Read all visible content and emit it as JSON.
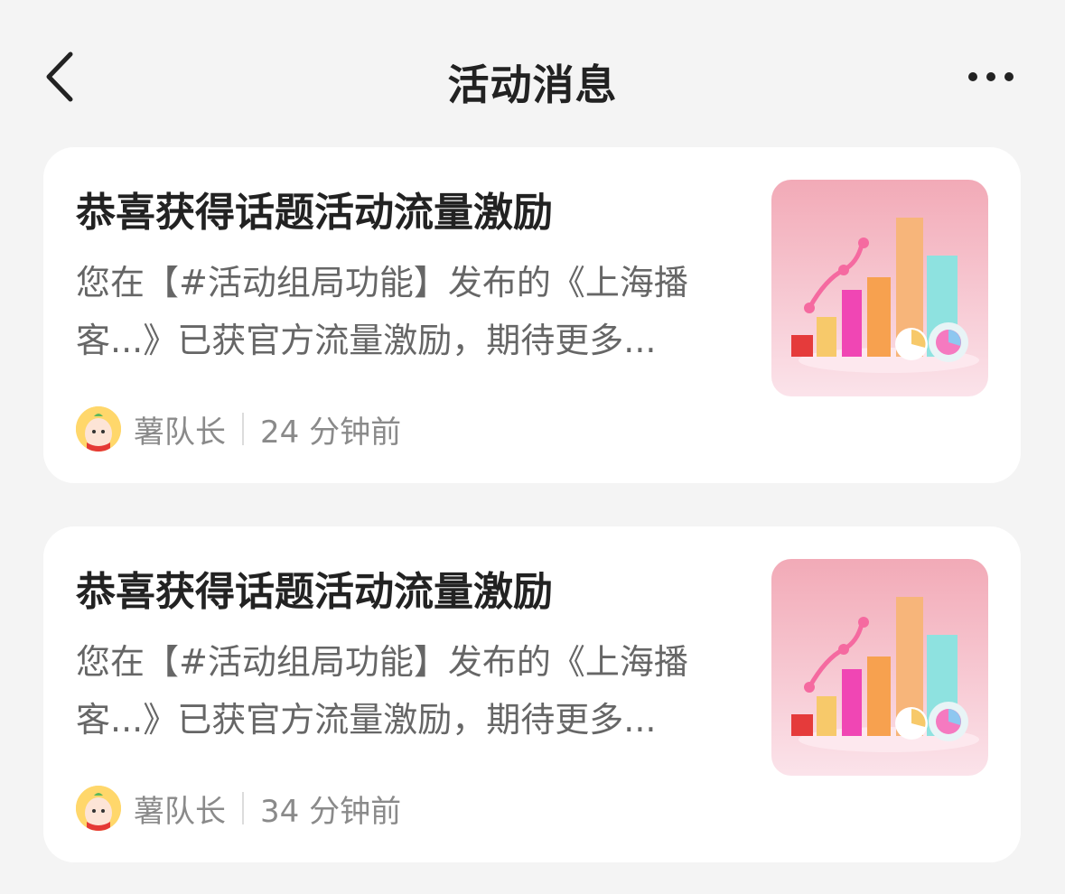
{
  "header": {
    "title": "活动消息",
    "back_icon": "chevron-left-icon",
    "more_icon": "more-dots-icon"
  },
  "messages": [
    {
      "title": "恭喜获得话题活动流量激励",
      "desc_line1": "您在【#活动组局功能】发布的《上海播",
      "desc_line2": "客...》已获官方流量激励，期待更多...",
      "author": "薯队长",
      "time": "24 分钟前",
      "thumbnail_icon": "bar-chart-illustration"
    },
    {
      "title": "恭喜获得话题活动流量激励",
      "desc_line1": "您在【#活动组局功能】发布的《上海播",
      "desc_line2": "客...》已获官方流量激励，期待更多...",
      "author": "薯队长",
      "time": "34 分钟前",
      "thumbnail_icon": "bar-chart-illustration"
    }
  ],
  "colors": {
    "background": "#f4f4f4",
    "card": "#ffffff",
    "title_text": "#222222",
    "desc_text": "#666666",
    "meta_text": "#8a8a8a",
    "thumb_bg": "#f4b6c0"
  }
}
